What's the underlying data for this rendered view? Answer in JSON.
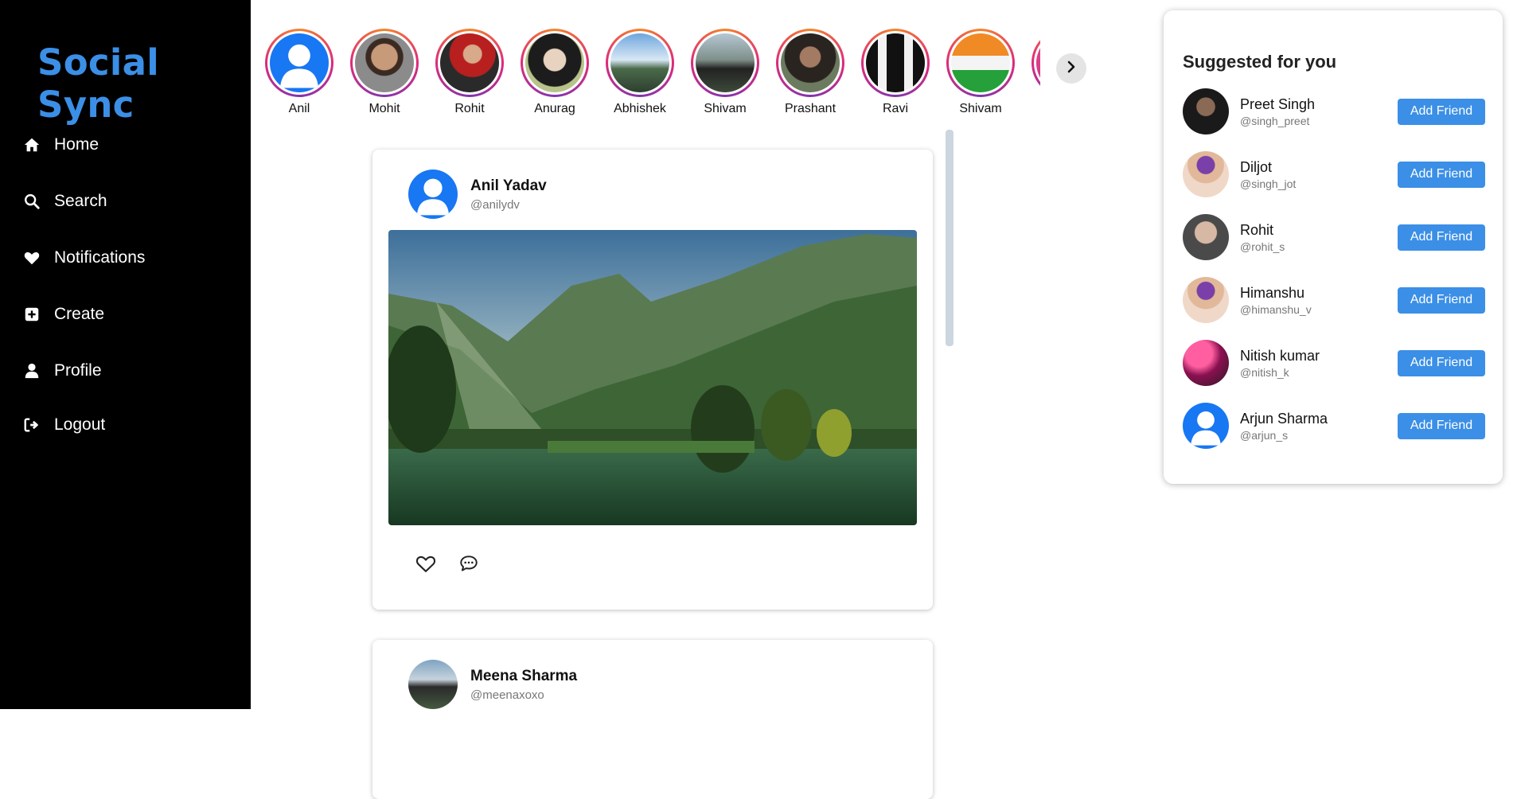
{
  "app": {
    "brand": "Social Sync"
  },
  "nav": [
    {
      "label": "Home",
      "icon": "home-icon"
    },
    {
      "label": "Search",
      "icon": "search-icon"
    },
    {
      "label": "Notifications",
      "icon": "heart-icon"
    },
    {
      "label": "Create",
      "icon": "plus-square-icon"
    },
    {
      "label": "Profile",
      "icon": "user-icon"
    },
    {
      "label": "Logout",
      "icon": "logout-icon"
    }
  ],
  "stories": [
    {
      "name": "Anil"
    },
    {
      "name": "Mohit"
    },
    {
      "name": "Rohit"
    },
    {
      "name": "Anurag"
    },
    {
      "name": "Abhishek"
    },
    {
      "name": "Shivam"
    },
    {
      "name": "Prashant"
    },
    {
      "name": "Ravi"
    },
    {
      "name": "Shivam"
    }
  ],
  "posts": [
    {
      "name": "Anil Yadav",
      "handle": "@anilydv"
    },
    {
      "name": "Meena Sharma",
      "handle": "@meenaxoxo"
    }
  ],
  "suggestions": {
    "title": "Suggested for you",
    "button_label": "Add Friend",
    "items": [
      {
        "name": "Preet Singh",
        "handle": "@singh_preet"
      },
      {
        "name": "Diljot",
        "handle": "@singh_jot"
      },
      {
        "name": "Rohit",
        "handle": "@rohit_s"
      },
      {
        "name": "Himanshu",
        "handle": "@himanshu_v"
      },
      {
        "name": "Nitish kumar",
        "handle": "@nitish_k"
      },
      {
        "name": "Arjun Sharma",
        "handle": "@arjun_s"
      }
    ]
  },
  "colors": {
    "accent": "#3b8fe6",
    "sidebar": "#000000",
    "default_avatar": "#1877f2"
  }
}
